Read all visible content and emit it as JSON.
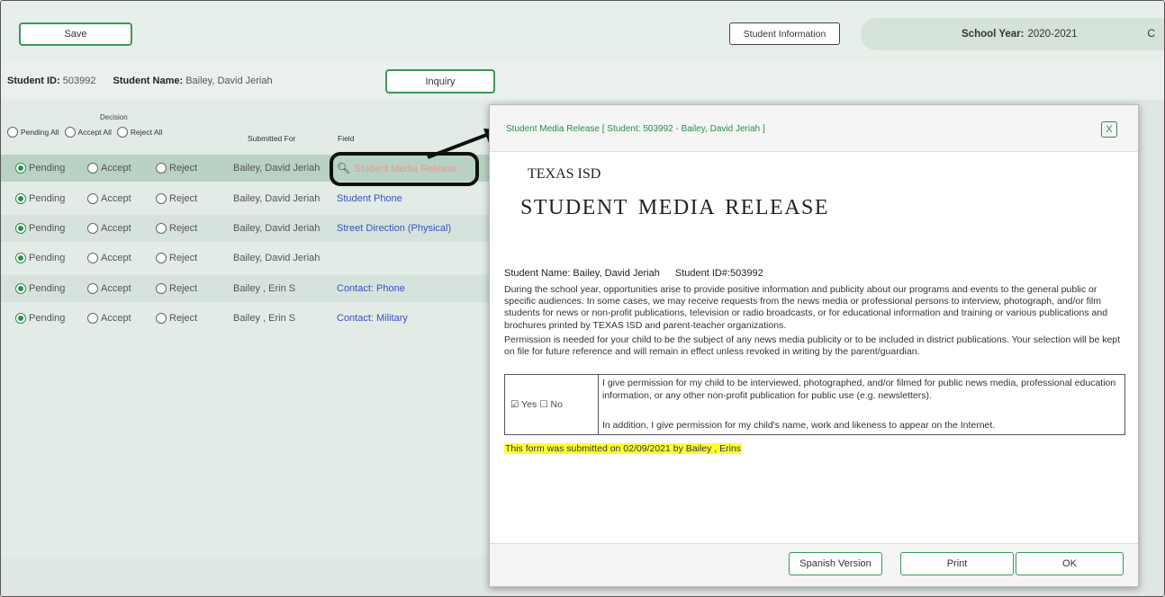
{
  "toolbar": {
    "save_label": "Save",
    "student_info_label": "Student Information",
    "school_year_label": "School Year:",
    "school_year_value": "2020-2021",
    "school_year_extra": "C"
  },
  "student": {
    "id_label": "Student ID:",
    "id_value": "503992",
    "name_label": "Student Name:",
    "name_value": "Bailey, David Jeriah",
    "inquiry_label": "Inquiry"
  },
  "table": {
    "decision_header": "Decision",
    "pending_all": "Pending All",
    "accept_all": "Accept All",
    "reject_all": "Reject All",
    "col_submitted_for": "Submitted For",
    "col_field": "Field",
    "rows": [
      {
        "pending": "Pending",
        "accept": "Accept",
        "reject": "Reject",
        "submitted_for": "Bailey, David Jeriah",
        "field": "Student Media Release"
      },
      {
        "pending": "Pending",
        "accept": "Accept",
        "reject": "Reject",
        "submitted_for": "Bailey, David Jeriah",
        "field": "Student Phone"
      },
      {
        "pending": "Pending",
        "accept": "Accept",
        "reject": "Reject",
        "submitted_for": "Bailey, David Jeriah",
        "field": "Street Direction (Physical)"
      },
      {
        "pending": "Pending",
        "accept": "Accept",
        "reject": "Reject",
        "submitted_for": "Bailey, David Jeriah",
        "field": ""
      },
      {
        "pending": "Pending",
        "accept": "Accept",
        "reject": "Reject",
        "submitted_for": "Bailey , Erin S",
        "field": "Contact: Phone"
      },
      {
        "pending": "Pending",
        "accept": "Accept",
        "reject": "Reject",
        "submitted_for": "Bailey , Erin S",
        "field": "Contact: Military"
      }
    ]
  },
  "modal": {
    "title": "Student Media Release [ Student: 503992 - Bailey, David Jeriah ]",
    "close_label": "X",
    "org": "TEXAS ISD",
    "doc_title": "STUDENT MEDIA RELEASE",
    "student_name_text": "Student Name: Bailey, David Jeriah",
    "student_id_text": "Student ID#:503992",
    "paragraph1": "During the school year, opportunities arise to provide positive information and publicity about our programs and events to the general public or specific audiences. In some cases, we may receive requests from the news media or professional persons to interview, photograph, and/or film students for news or non-profit publications, television or radio broadcasts, or for educational information and training or various publications and brochures printed by TEXAS ISD and parent-teacher organizations.",
    "paragraph2": "Permission is needed for your child to be the subject of any news media publicity or to be included in district publications. Your selection will be kept on file for future reference and will remain in effect unless revoked in writing by the parent/guardian.",
    "choice_yes": "☑ Yes",
    "choice_no": "☐ No",
    "permission1": "I give permission for my child to be interviewed, photographed, and/or filmed for public news media, professional education information, or any other non-profit publication for public use (e.g. newsletters).",
    "permission2": "In addition, I give permission for my child's name, work and likeness to appear on the Internet.",
    "submitted_note": "This form was submitted on 02/09/2021 by Bailey , Erins",
    "spanish_label": "Spanish Version",
    "print_label": "Print",
    "ok_label": "OK"
  },
  "icons": {
    "search": "search-icon",
    "close": "close-icon"
  },
  "colors": {
    "accent_green": "#2e8b4f",
    "link_blue": "#3b4fc4",
    "highlight_yellow": "#ffff33"
  }
}
